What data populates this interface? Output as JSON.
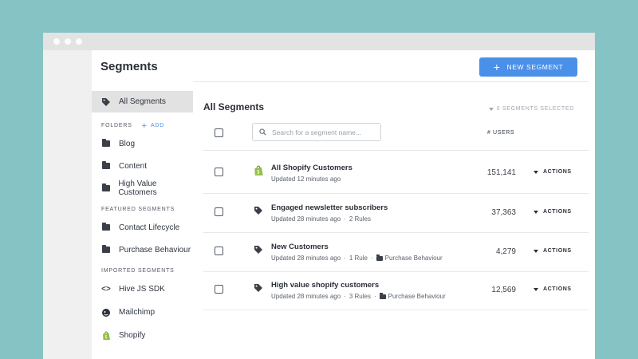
{
  "header": {
    "title": "Segments",
    "new_segment_label": "NEW SEGMENT"
  },
  "sidebar": {
    "all_segments": "All Segments",
    "folders_heading": "FOLDERS",
    "add_label": "ADD",
    "folders": [
      {
        "label": "Blog"
      },
      {
        "label": "Content"
      },
      {
        "label": "High Value Customers"
      }
    ],
    "featured_heading": "FEATURED SEGMENTS",
    "featured": [
      {
        "label": "Contact Lifecycle"
      },
      {
        "label": "Purchase Behaviour"
      }
    ],
    "imported_heading": "IMPORTED SEGMENTS",
    "imported": [
      {
        "label": "Hive JS SDK",
        "icon": "code-icon"
      },
      {
        "label": "Mailchimp",
        "icon": "mailchimp-icon"
      },
      {
        "label": "Shopify",
        "icon": "shopify-icon"
      }
    ]
  },
  "main": {
    "title": "All Segments",
    "selected_info": "0 SEGMENTS SELECTED",
    "search_placeholder": "Search for a segment name...",
    "users_column": "# USERS",
    "actions_label": "ACTIONS",
    "segments": [
      {
        "name": "All Shopify Customers",
        "updated": "Updated 12 minutes ago",
        "rules": "",
        "folder": "",
        "users": "151,141",
        "icon": "shopify-icon"
      },
      {
        "name": "Engaged newsletter subscribers",
        "updated": "Updated 28 minutes ago",
        "rules": "2 Rules",
        "folder": "",
        "users": "37,363",
        "icon": "tag-icon"
      },
      {
        "name": "New Customers",
        "updated": "Updated 28 minutes ago",
        "rules": "1 Rule",
        "folder": "Purchase Behaviour",
        "users": "4,279",
        "icon": "tag-icon"
      },
      {
        "name": "High value shopify customers",
        "updated": "Updated 28 minutes ago",
        "rules": "3 Rules",
        "folder": "Purchase Behaviour",
        "users": "12,569",
        "icon": "tag-icon"
      }
    ]
  },
  "colors": {
    "background": "#86c3c4",
    "accent": "#4a90e8",
    "shopify_green": "#95bf47"
  }
}
